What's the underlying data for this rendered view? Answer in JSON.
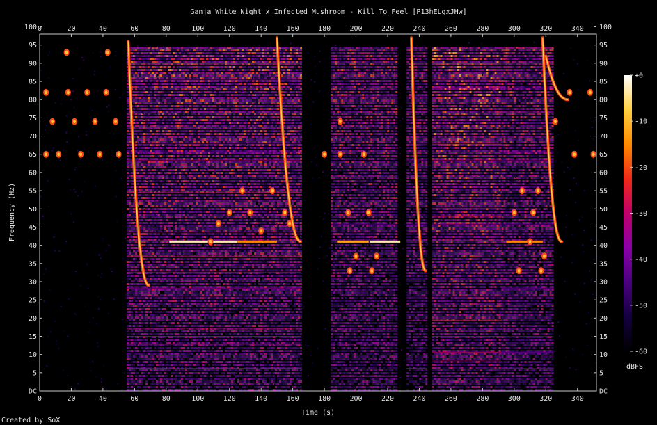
{
  "chart_data": {
    "type": "heatmap",
    "title": "Ganja White Night x Infected Mushroom - Kill To Feel [P13hELgxJHw]",
    "xlabel": "Time (s)",
    "ylabel": "Frequency (Hz)",
    "xlim": [
      0,
      352
    ],
    "ylim": [
      0,
      98
    ],
    "x_ticks": [
      "0",
      "20",
      "40",
      "60",
      "80",
      "100",
      "120",
      "140",
      "160",
      "180",
      "200",
      "220",
      "240",
      "260",
      "280",
      "300",
      "320",
      "340"
    ],
    "y_ticks": [
      "DC",
      "5",
      "10",
      "15",
      "20",
      "25",
      "30",
      "35",
      "40",
      "45",
      "50",
      "55",
      "60",
      "65",
      "70",
      "75",
      "80",
      "85",
      "90",
      "95",
      "100"
    ],
    "colorbar": {
      "label": "dBFS",
      "range": [
        -60,
        0
      ],
      "ticks": [
        "+0",
        "-10",
        "-20",
        "-30",
        "-40",
        "-50",
        "-60"
      ],
      "colors": [
        "#000000",
        "#140040",
        "#4a0080",
        "#8a00a8",
        "#c0006a",
        "#ee2a1a",
        "#ff8a00",
        "#ffd040",
        "#ffffff"
      ]
    },
    "dense_regions": [
      {
        "start": 55,
        "end": 165,
        "level": 0.55
      },
      {
        "start": 184,
        "end": 226,
        "level": 0.5
      },
      {
        "start": 232,
        "end": 245,
        "level": 0.45
      },
      {
        "start": 248,
        "end": 292,
        "level": 0.6
      },
      {
        "start": 292,
        "end": 325,
        "level": 0.5
      }
    ],
    "sweeps": [
      {
        "start": 56,
        "end": 69,
        "f_start": 96,
        "f_end": 29
      },
      {
        "start": 150,
        "end": 165,
        "f_start": 97,
        "f_end": 41
      },
      {
        "start": 235,
        "end": 244,
        "f_start": 97,
        "f_end": 33
      },
      {
        "start": 318,
        "end": 330,
        "f_start": 97,
        "f_end": 41
      },
      {
        "start": 320,
        "end": 334,
        "f_start": 92,
        "f_end": 80
      }
    ],
    "tones": [
      {
        "start": 82,
        "end": 125,
        "freq": 41,
        "level": 0.95
      },
      {
        "start": 125,
        "end": 150,
        "freq": 41,
        "level": 0.75
      },
      {
        "start": 209,
        "end": 228,
        "freq": 41,
        "level": 0.95
      },
      {
        "start": 188,
        "end": 208,
        "freq": 41,
        "level": 0.8
      },
      {
        "start": 295,
        "end": 318,
        "freq": 41,
        "level": 0.75
      }
    ],
    "pulses": [
      {
        "t": 4,
        "f": 65
      },
      {
        "t": 12,
        "f": 65
      },
      {
        "t": 26,
        "f": 65
      },
      {
        "t": 38,
        "f": 65
      },
      {
        "t": 50,
        "f": 65
      },
      {
        "t": 17,
        "f": 93
      },
      {
        "t": 43,
        "f": 93
      },
      {
        "t": 4,
        "f": 82
      },
      {
        "t": 18,
        "f": 82
      },
      {
        "t": 30,
        "f": 82
      },
      {
        "t": 42,
        "f": 82
      },
      {
        "t": 8,
        "f": 74
      },
      {
        "t": 22,
        "f": 74
      },
      {
        "t": 35,
        "f": 74
      },
      {
        "t": 48,
        "f": 74
      },
      {
        "t": 108,
        "f": 41
      },
      {
        "t": 113,
        "f": 46
      },
      {
        "t": 120,
        "f": 49
      },
      {
        "t": 128,
        "f": 55
      },
      {
        "t": 133,
        "f": 49
      },
      {
        "t": 140,
        "f": 44
      },
      {
        "t": 147,
        "f": 55
      },
      {
        "t": 155,
        "f": 49
      },
      {
        "t": 158,
        "f": 46
      },
      {
        "t": 190,
        "f": 74
      },
      {
        "t": 195,
        "f": 49
      },
      {
        "t": 196,
        "f": 33
      },
      {
        "t": 200,
        "f": 37
      },
      {
        "t": 205,
        "f": 65
      },
      {
        "t": 208,
        "f": 49
      },
      {
        "t": 210,
        "f": 33
      },
      {
        "t": 213,
        "f": 37
      },
      {
        "t": 300,
        "f": 49
      },
      {
        "t": 305,
        "f": 55
      },
      {
        "t": 303,
        "f": 33
      },
      {
        "t": 310,
        "f": 41
      },
      {
        "t": 312,
        "f": 49
      },
      {
        "t": 315,
        "f": 55
      },
      {
        "t": 317,
        "f": 33
      },
      {
        "t": 319,
        "f": 37
      },
      {
        "t": 180,
        "f": 65
      },
      {
        "t": 190,
        "f": 65
      },
      {
        "t": 326,
        "f": 74
      },
      {
        "t": 338,
        "f": 65
      },
      {
        "t": 350,
        "f": 65
      },
      {
        "t": 335,
        "f": 82
      },
      {
        "t": 348,
        "f": 82
      }
    ]
  },
  "footer": {
    "credit": "Created by SoX"
  }
}
